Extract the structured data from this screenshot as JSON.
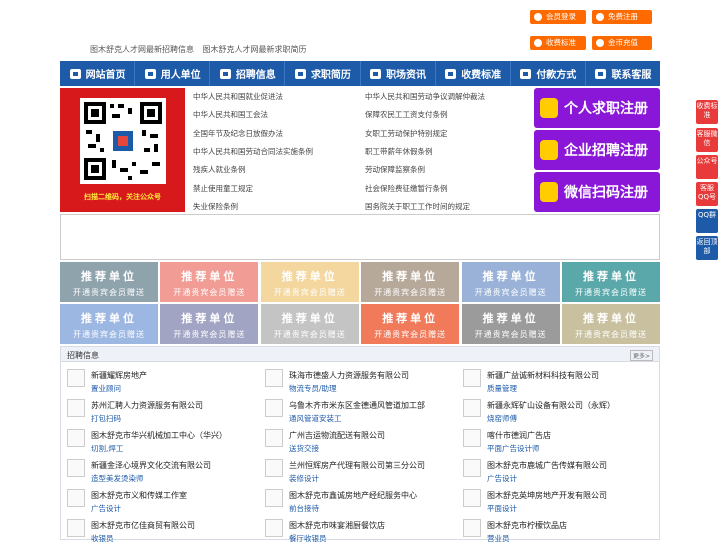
{
  "top_links": [
    "图木舒克人才网最新招聘信息",
    "图木舒克人才网最新求职简历"
  ],
  "top_buttons": [
    {
      "label": "会员登录",
      "icon": "user-icon"
    },
    {
      "label": "免费注册",
      "icon": "user-plus-icon"
    },
    {
      "label": "收费标准",
      "icon": "yen-icon"
    },
    {
      "label": "金币充值",
      "icon": "coin-icon"
    }
  ],
  "nav": [
    {
      "label": "网站首页",
      "icon": "home-icon"
    },
    {
      "label": "用人单位",
      "icon": "building-icon"
    },
    {
      "label": "招聘信息",
      "icon": "megaphone-icon"
    },
    {
      "label": "求职简历",
      "icon": "resume-icon"
    },
    {
      "label": "职场资讯",
      "icon": "news-icon"
    },
    {
      "label": "收费标准",
      "icon": "yen-icon"
    },
    {
      "label": "付款方式",
      "icon": "payment-icon"
    },
    {
      "label": "联系客服",
      "icon": "phone-icon"
    }
  ],
  "qr_caption": "扫描二维码，关注公众号",
  "laws_left": [
    "中华人民共和国就业促进法",
    "中华人民共和国工会法",
    "全国年节及纪念日放假办法",
    "中华人民共和国劳动合同法实施条例",
    "残疾人就业条例",
    "禁止使用童工规定",
    "失业保险条例"
  ],
  "laws_right": [
    "中华人民共和国劳动争议调解仲裁法",
    "保障农民工工资支付条例",
    "女职工劳动保护特别规定",
    "职工带薪年休假条例",
    "劳动保障监察条例",
    "社会保险费征缴暂行条例",
    "国务院关于职工工作时间的规定"
  ],
  "register_buttons": [
    {
      "label": "个人求职注册",
      "icon": "person-icon"
    },
    {
      "label": "企业招聘注册",
      "icon": "enterprise-icon"
    },
    {
      "label": "微信扫码注册",
      "icon": "wechat-icon"
    }
  ],
  "tiles": {
    "title": "推荐单位",
    "subtitle": "开通贵宾会员赠送",
    "colors": [
      "#8fa3ad",
      "#f19c95",
      "#f3d79e",
      "#b7a99a",
      "#9ab2d8",
      "#5aa8aa",
      "#9db7e3",
      "#a2a4c3",
      "#c4c4c4",
      "#f07a5a",
      "#9b9b9b",
      "#c9c0a0"
    ]
  },
  "jobs_title": "招聘信息",
  "jobs_more": "更多>",
  "jobs": [
    {
      "company": "新疆耀辉房地产",
      "position": "置业顾问"
    },
    {
      "company": "珠海市德盛人力资源服务有限公司",
      "position": "物流专员/助理"
    },
    {
      "company": "新疆广益诚新材料科技有限公司",
      "position": "质量管理"
    },
    {
      "company": "苏州汇聘人力资源服务有限公司",
      "position": "打包扫码"
    },
    {
      "company": "乌鲁木齐市米东区金德通风管道加工部",
      "position": "通风管道安装工"
    },
    {
      "company": "新疆永辉矿山设备有限公司（永辉）",
      "position": "烧窑师傅"
    },
    {
      "company": "图木舒克市华兴机械加工中心（华兴）",
      "position": "切割,焊工"
    },
    {
      "company": "广州吉运物流配送有限公司",
      "position": "送货交接"
    },
    {
      "company": "喀什市德润广告店",
      "position": "平面广告设计师"
    },
    {
      "company": "新疆金泽心境界文化交流有限公司",
      "position": "造型美发烫染师"
    },
    {
      "company": "兰州恒辉房产代理有限公司第三分公司",
      "position": "装修设计"
    },
    {
      "company": "图木舒克市鹿城广告传媒有限公司",
      "position": "广告设计"
    },
    {
      "company": "图木舒克市义和传媒工作室",
      "position": "广告设计"
    },
    {
      "company": "图木舒克市鑫诚房地产经纪服务中心",
      "position": "前台接待"
    },
    {
      "company": "图木舒克英坤房地产开发有限公司",
      "position": "平面设计"
    },
    {
      "company": "图木舒克市亿佳商贸有限公司",
      "position": "收银员"
    },
    {
      "company": "图木舒克市味宴湘厨餐饮店",
      "position": "餐厅收银员"
    },
    {
      "company": "图木舒克市柠檬饮品店",
      "position": "营业员"
    }
  ],
  "side_buttons": [
    "收费标准",
    "客服微信",
    "公众号",
    "客服QQ号",
    "QQ群",
    "返回顶部"
  ]
}
